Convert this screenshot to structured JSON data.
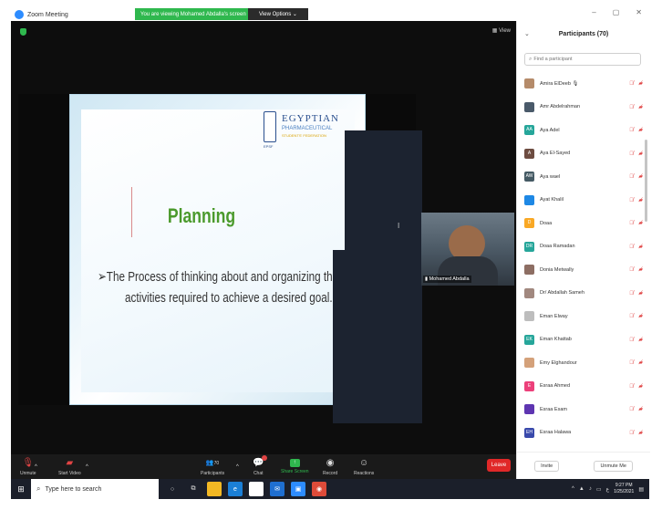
{
  "window": {
    "title": "Zoom Meeting",
    "viewing_banner": "You are viewing Mohamed Abdalla's screen",
    "view_options": "View Options",
    "view_label": "View",
    "minimize": "–",
    "restore": "▢",
    "close": "✕"
  },
  "slide": {
    "logo_line1": "EGYPTIAN",
    "logo_line2": "PHARMACEUTICAL",
    "logo_line3": "STUDENTS' FEDERATION",
    "logo_abbr": "EPSF",
    "title": "Planning",
    "bullet_line1": "➢The Process of thinking about and organizing the",
    "bullet_line2": "activities required to achieve a desired goal."
  },
  "video": {
    "name": "Mohamed Abdalla"
  },
  "toolbar": {
    "unmute": "Unmute",
    "start_video": "Start Video",
    "participants": "Participants",
    "participants_count": "70",
    "chat": "Chat",
    "share_screen": "Share Screen",
    "record": "Record",
    "reactions": "Reactions",
    "leave": "Leave"
  },
  "panel": {
    "title": "Participants (70)",
    "search_placeholder": "Find a participant",
    "invite": "Invite",
    "unmute_me": "Unmute Me",
    "participants": [
      {
        "name": "Amira ElDeeb 🎙",
        "initials": "",
        "color": "#b58b6a"
      },
      {
        "name": "Amr Abdelrahman",
        "initials": "",
        "color": "#4a5a6a"
      },
      {
        "name": "Aya Adel",
        "initials": "AA",
        "color": "#26a69a"
      },
      {
        "name": "Aya El-Sayed",
        "initials": "A",
        "color": "#6d4c41"
      },
      {
        "name": "Aya wael",
        "initials": "AW",
        "color": "#455a64"
      },
      {
        "name": "Ayat Khalil",
        "initials": "",
        "color": "#1e88e5"
      },
      {
        "name": "Doaa",
        "initials": "D",
        "color": "#f9a825"
      },
      {
        "name": "Doaa Ramadan",
        "initials": "DR",
        "color": "#26a69a"
      },
      {
        "name": "Donia Metwally",
        "initials": "",
        "color": "#8d6e63"
      },
      {
        "name": "Dr/ Abdallah Sameh",
        "initials": "",
        "color": "#a1887f"
      },
      {
        "name": "Eman Elway",
        "initials": "",
        "color": "#bdbdbd"
      },
      {
        "name": "Eman Khattab",
        "initials": "EK",
        "color": "#26a69a"
      },
      {
        "name": "Emy Elghandour",
        "initials": "",
        "color": "#d4a17a"
      },
      {
        "name": "Esraa Ahmed",
        "initials": "E",
        "color": "#ec407a"
      },
      {
        "name": "Esraa Esam",
        "initials": "",
        "color": "#5e35b1"
      },
      {
        "name": "Esraa Halawa",
        "initials": "EH",
        "color": "#3949ab"
      }
    ]
  },
  "taskbar": {
    "search": "Type here to search",
    "time": "9:27 PM",
    "date": "1/25/2021"
  }
}
